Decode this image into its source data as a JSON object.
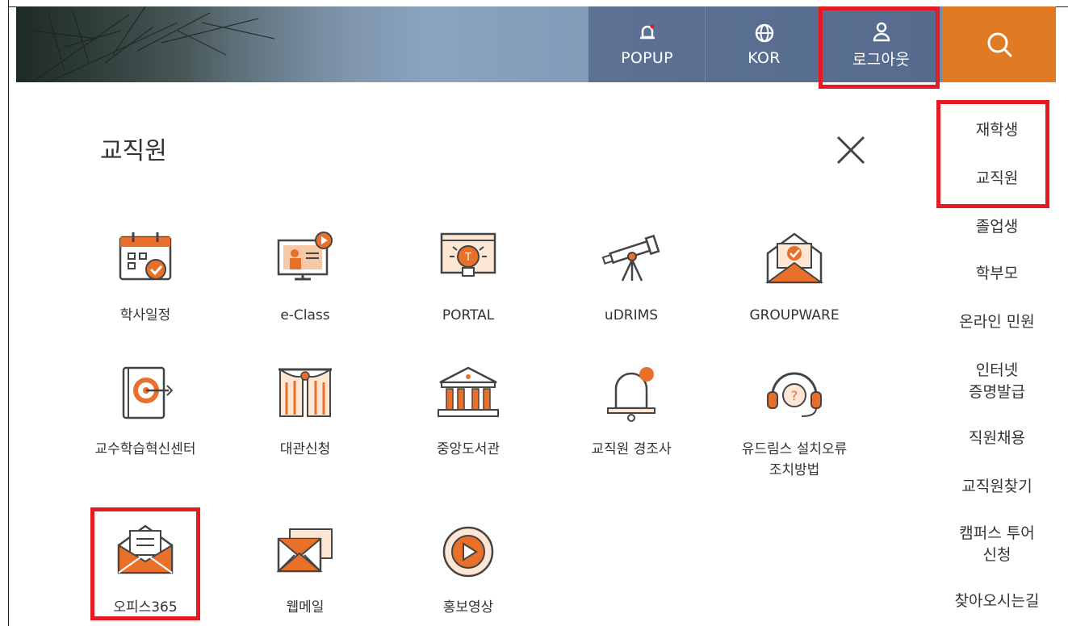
{
  "header": {
    "buttons": [
      {
        "icon": "bell-icon",
        "label": "POPUP"
      },
      {
        "icon": "globe-icon",
        "label": "KOR"
      },
      {
        "icon": "user-icon",
        "label": "로그아웃"
      }
    ],
    "search_icon": "search-icon",
    "accent_color": "#e07b24"
  },
  "panel": {
    "title": "교직원",
    "close_icon": "close-icon",
    "items": [
      {
        "icon": "calendar-icon",
        "label": "학사일정"
      },
      {
        "icon": "video-lecture-icon",
        "label": "e-Class"
      },
      {
        "icon": "lightbulb-icon",
        "label": "PORTAL"
      },
      {
        "icon": "telescope-icon",
        "label": "uDRIMS"
      },
      {
        "icon": "mail-check-icon",
        "label": "GROUPWARE"
      },
      {
        "icon": "target-book-icon",
        "label": "교수학습혁신센터"
      },
      {
        "icon": "stage-curtain-icon",
        "label": "대관신청"
      },
      {
        "icon": "library-building-icon",
        "label": "중앙도서관"
      },
      {
        "icon": "bell-icon",
        "label": "교직원 경조사"
      },
      {
        "icon": "headset-help-icon",
        "label": "유드림스 설치오류\n조치방법"
      },
      {
        "icon": "open-envelope-icon",
        "label": "오피스365"
      },
      {
        "icon": "envelope-icon",
        "label": "웹메일"
      },
      {
        "icon": "play-icon",
        "label": "홍보영상"
      }
    ]
  },
  "right_menu": {
    "items": [
      {
        "label": "재학생"
      },
      {
        "label": "교직원"
      },
      {
        "label": "졸업생"
      },
      {
        "label": "학부모"
      },
      {
        "label": "온라인 민원"
      },
      {
        "label": "인터넷\n증명발급"
      },
      {
        "label": "직원채용"
      },
      {
        "label": "교직원찾기"
      },
      {
        "label": "캠퍼스 투어\n신청"
      },
      {
        "label": "찾아오시는길"
      }
    ]
  },
  "highlight_color": "#e41b23"
}
